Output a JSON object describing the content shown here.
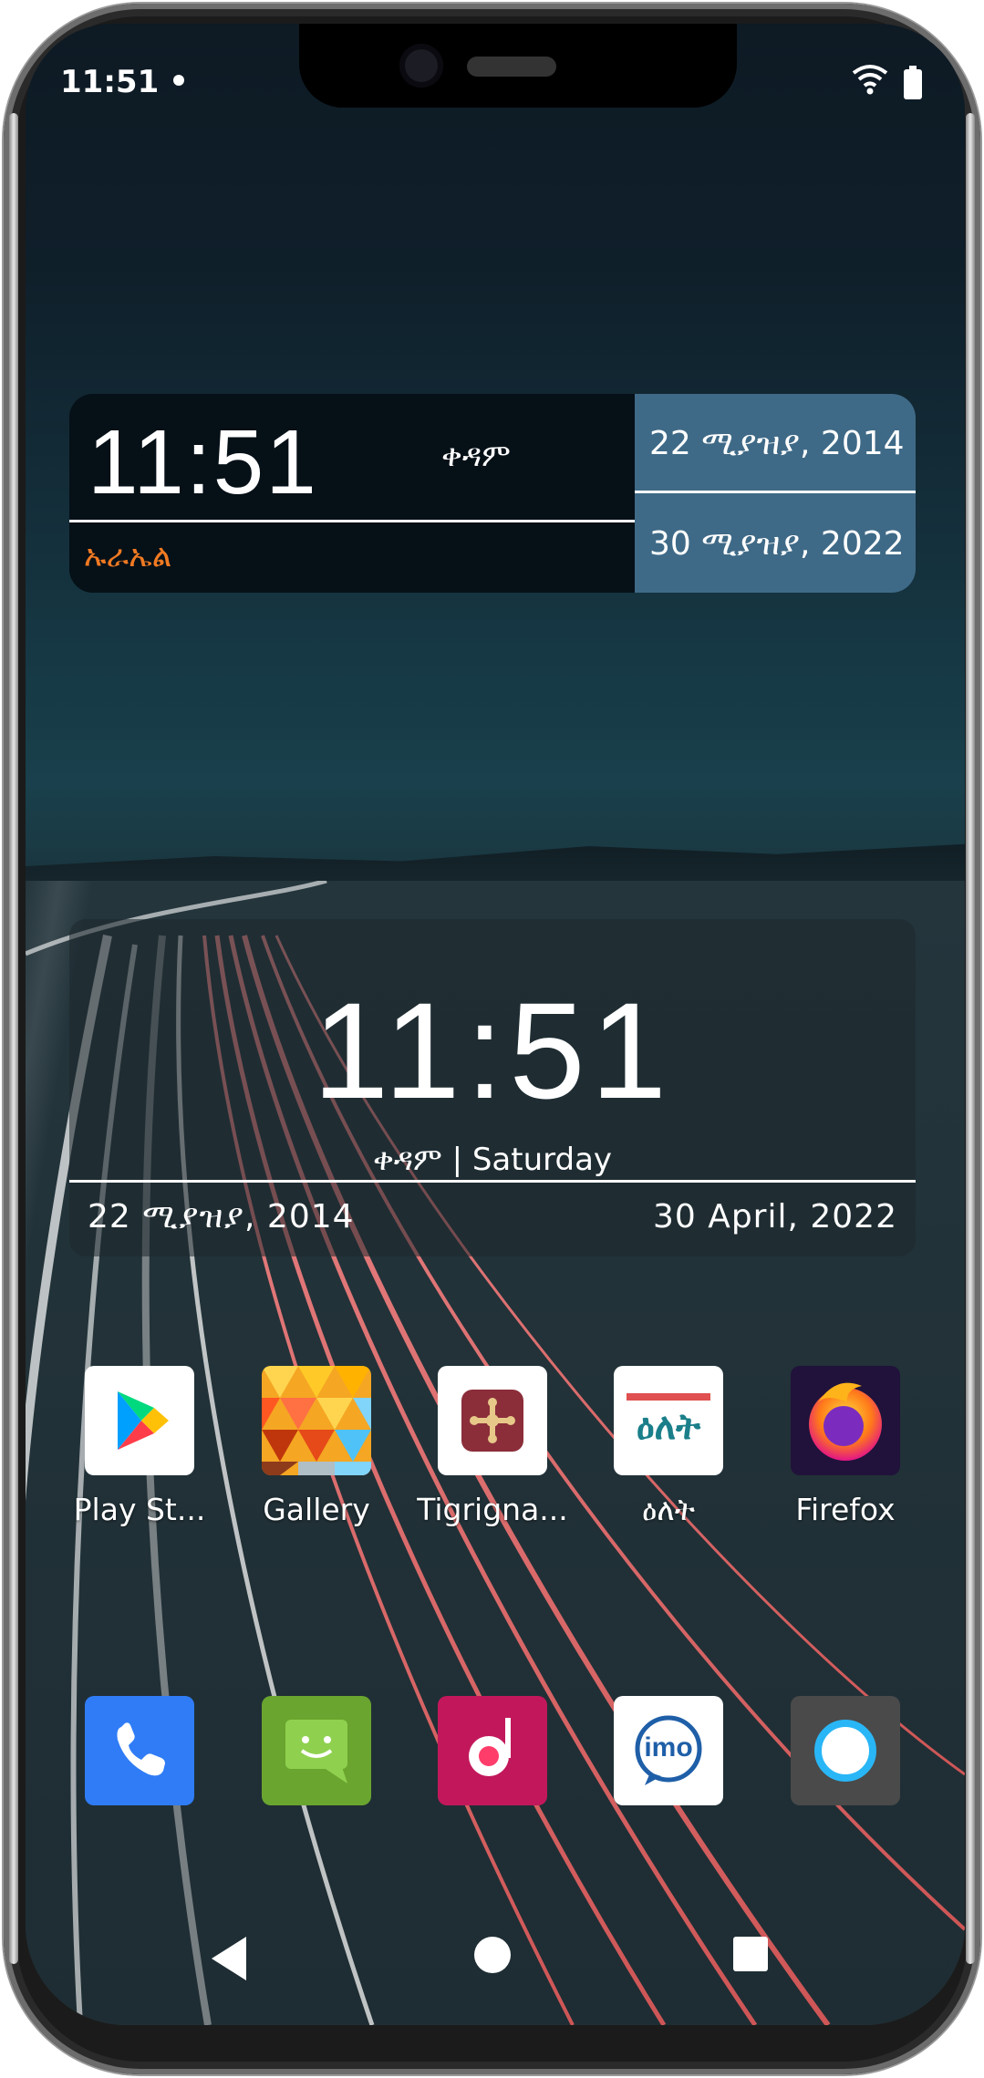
{
  "status_bar": {
    "time": "11:51"
  },
  "widget_clock_1": {
    "time": "11:51",
    "ampm": "ቀዳም",
    "day_name": "ኡራኤል",
    "date_ethiopian": "22 ሚያዝያ, 2014",
    "date_gregorian": "30 ሚያዝያ, 2022"
  },
  "widget_clock_2": {
    "time": "11:51",
    "subtitle": "ቀዳም | Saturday",
    "date_ethiopian": "22  ሚያዝያ,  2014",
    "date_gregorian": "30  April,  2022"
  },
  "apps_row1": [
    {
      "label": "Play St...",
      "icon": "play-store-icon"
    },
    {
      "label": "Gallery",
      "icon": "gallery-icon"
    },
    {
      "label": "Tigrigna...",
      "icon": "tigrigna-icon"
    },
    {
      "label": "ዕለት",
      "icon": "elet-icon"
    },
    {
      "label": "Firefox",
      "icon": "firefox-icon"
    }
  ],
  "dock": [
    {
      "icon": "phone-icon"
    },
    {
      "icon": "messaging-icon"
    },
    {
      "icon": "music-icon"
    },
    {
      "icon": "imo-icon"
    },
    {
      "icon": "browser-icon"
    }
  ],
  "icon_texts": {
    "elet": "ዕለት",
    "imo": "imo"
  },
  "colors": {
    "accent_orange": "#f07a22",
    "widget_blue": "#3f6a87"
  }
}
